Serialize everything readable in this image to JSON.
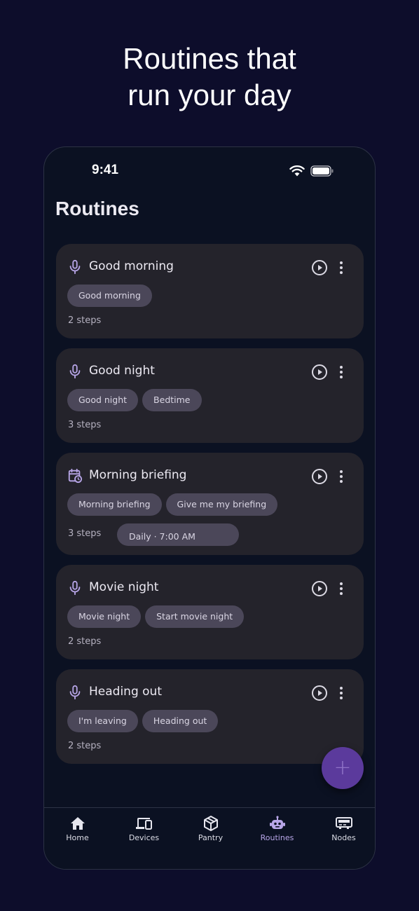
{
  "headline": {
    "line1": "Routines that",
    "line2": "run your day"
  },
  "status_bar": {
    "time": "9:41"
  },
  "page": {
    "title": "Routines"
  },
  "routines": [
    {
      "title": "Good morning",
      "trigger_icon": "mic-icon",
      "chips": [
        "Good morning"
      ],
      "steps": "2 steps"
    },
    {
      "title": "Good night",
      "trigger_icon": "mic-icon",
      "chips": [
        "Good night",
        "Bedtime"
      ],
      "steps": "3 steps"
    },
    {
      "title": "Morning briefing",
      "trigger_icon": "calendar-clock-icon",
      "chips": [
        "Morning briefing",
        "Give me my briefing"
      ],
      "steps": "3 steps",
      "schedule": "Daily · 7:00 AM"
    },
    {
      "title": "Movie night",
      "trigger_icon": "mic-icon",
      "chips": [
        "Movie night",
        "Start movie night"
      ],
      "steps": "2 steps"
    },
    {
      "title": "Heading out",
      "trigger_icon": "mic-icon",
      "chips": [
        "I'm leaving",
        "Heading out"
      ],
      "steps": "2 steps"
    }
  ],
  "fab": {
    "label": "+"
  },
  "nav": {
    "items": [
      {
        "label": "Home",
        "icon": "home-icon"
      },
      {
        "label": "Devices",
        "icon": "devices-icon"
      },
      {
        "label": "Pantry",
        "icon": "package-icon"
      },
      {
        "label": "Routines",
        "icon": "robot-icon",
        "active": true
      },
      {
        "label": "Nodes",
        "icon": "router-icon"
      }
    ]
  },
  "colors": {
    "background": "#0d0d2b",
    "card": "#24232b",
    "chip": "#4b4759",
    "accent": "#b8a6e8",
    "fab": "#5b3a9c"
  }
}
